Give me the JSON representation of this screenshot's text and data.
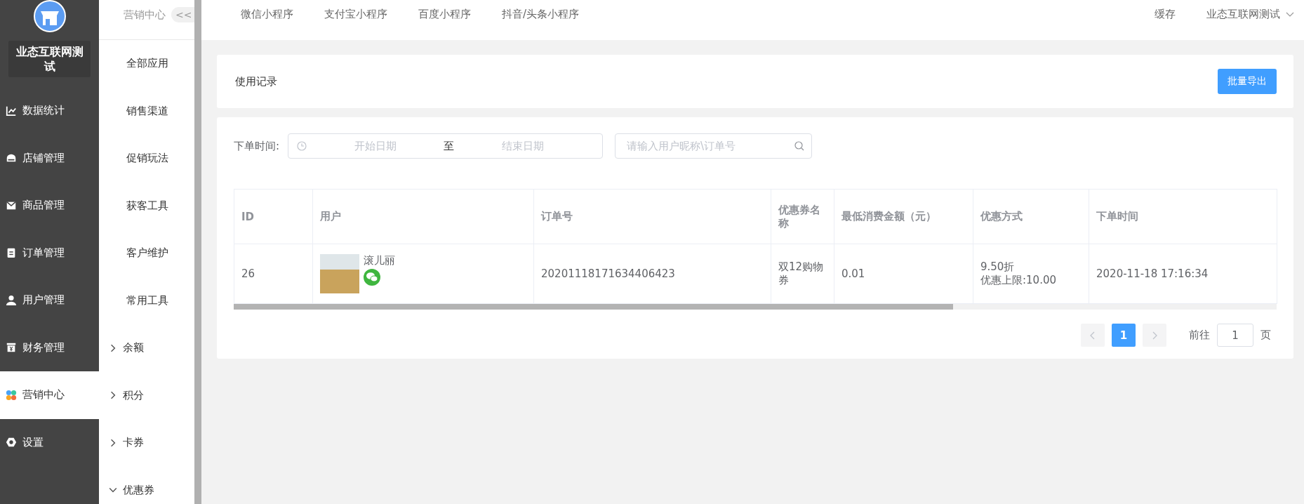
{
  "sidebar": {
    "brand": "业态互联网测试",
    "items": [
      {
        "label": "数据统计",
        "selected": false
      },
      {
        "label": "店铺管理",
        "selected": false
      },
      {
        "label": "商品管理",
        "selected": false
      },
      {
        "label": "订单管理",
        "selected": false
      },
      {
        "label": "用户管理",
        "selected": false
      },
      {
        "label": "财务管理",
        "selected": false
      },
      {
        "label": "营销中心",
        "selected": true
      },
      {
        "label": "设置",
        "selected": false
      }
    ]
  },
  "submenu": {
    "title": "营销中心",
    "collapse": "<<",
    "items": [
      {
        "label": "全部应用",
        "kind": "link"
      },
      {
        "label": "销售渠道",
        "kind": "link"
      },
      {
        "label": "促销玩法",
        "kind": "link"
      },
      {
        "label": "获客工具",
        "kind": "link"
      },
      {
        "label": "客户维护",
        "kind": "link"
      },
      {
        "label": "常用工具",
        "kind": "link"
      },
      {
        "label": "余额",
        "kind": "group",
        "expanded": false
      },
      {
        "label": "积分",
        "kind": "group",
        "expanded": false
      },
      {
        "label": "卡券",
        "kind": "group",
        "expanded": false
      },
      {
        "label": "优惠券",
        "kind": "group",
        "expanded": true
      }
    ]
  },
  "top_nav": {
    "tabs": [
      "微信小程序",
      "支付宝小程序",
      "百度小程序",
      "抖音/头条小程序"
    ],
    "cache": "缓存",
    "account": "业态互联网测试"
  },
  "header_card": {
    "title": "使用记录",
    "export_button": "批量导出"
  },
  "filter": {
    "label": "下单时间:",
    "start_placeholder": "开始日期",
    "separator": "至",
    "end_placeholder": "结束日期",
    "search_placeholder": "请输入用户昵称\\订单号"
  },
  "table": {
    "columns": [
      "ID",
      "用户",
      "订单号",
      "优惠券名称",
      "最低消费金额（元）",
      "优惠方式",
      "下单时间"
    ],
    "rows": [
      {
        "id": "26",
        "user": "滚儿丽",
        "order_no": "20201118171634406423",
        "coupon": "双12购物券",
        "min_amount": "0.01",
        "discount": [
          "9.50折",
          "优惠上限:10.00"
        ],
        "time": "2020-11-18 17:16:34"
      }
    ]
  },
  "pagination": {
    "pages": [
      {
        "label": "1",
        "selected": true
      }
    ],
    "goto_label": "前往",
    "goto_value": "1",
    "page_suffix": "页"
  }
}
